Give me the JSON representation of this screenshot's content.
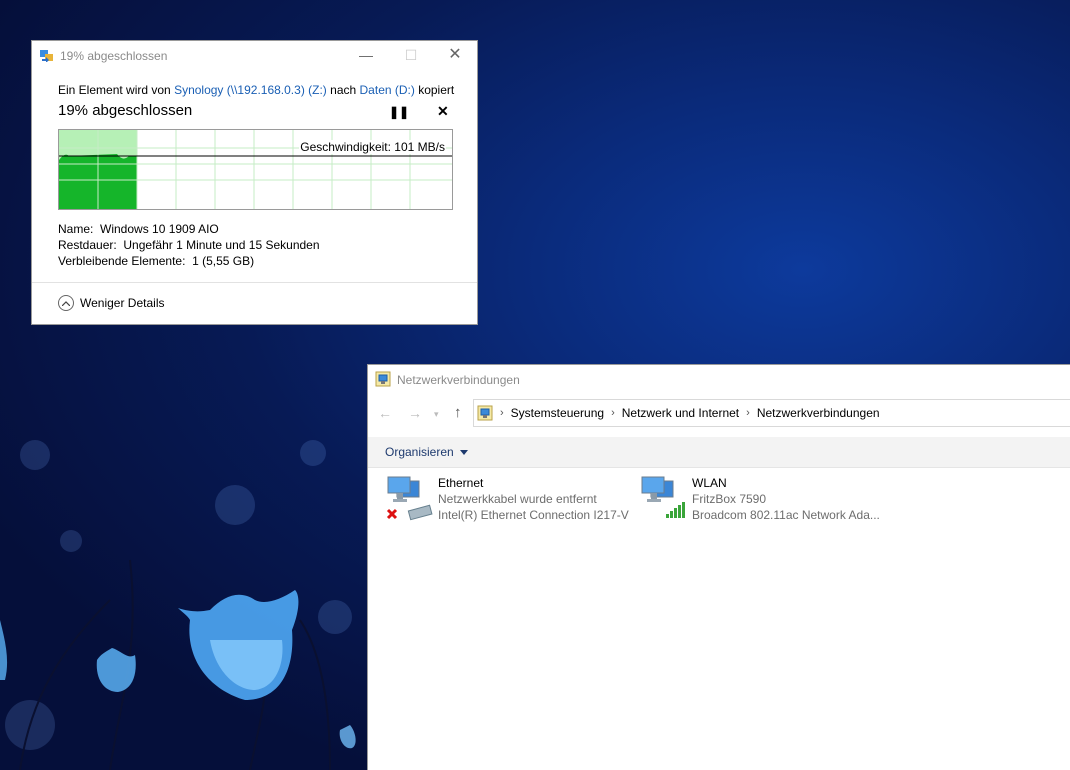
{
  "copy_dialog": {
    "title": "19% abgeschlossen",
    "line_prefix": "Ein Element wird von ",
    "source": "Synology (\\\\192.168.0.3) (Z:)",
    "line_mid": " nach ",
    "destination": "Daten (D:)",
    "line_suffix": " kopiert",
    "heading": "19% abgeschlossen",
    "progress_fraction": 0.19,
    "speed_label": "Geschwindigkeit: 101 MB/s",
    "details": {
      "name_label": "Name:",
      "name_value": "Windows 10 1909 AIO",
      "remaining_label": "Restdauer:",
      "remaining_value": "Ungefähr 1 Minute und 15 Sekunden",
      "items_label": "Verbleibende Elemente:",
      "items_value": "1 (5,55 GB)"
    },
    "less_details_label": "Weniger Details",
    "colors": {
      "graph_fill": "#15b52a",
      "graph_light": "#b6f0b6",
      "grid": "#c6ecc6"
    }
  },
  "explorer": {
    "title": "Netzwerkverbindungen",
    "breadcrumb": [
      "Systemsteuerung",
      "Netzwerk und Internet",
      "Netzwerkverbindungen"
    ],
    "organize_label": "Organisieren",
    "connections": [
      {
        "name": "Ethernet",
        "status": "Netzwerkkabel wurde entfernt",
        "device": "Intel(R) Ethernet Connection I217-V",
        "icon": "ethernet-disconnected-icon"
      },
      {
        "name": "WLAN",
        "status": "FritzBox 7590",
        "device": "Broadcom 802.11ac Network Ada...",
        "icon": "wlan-signal-icon"
      }
    ]
  }
}
